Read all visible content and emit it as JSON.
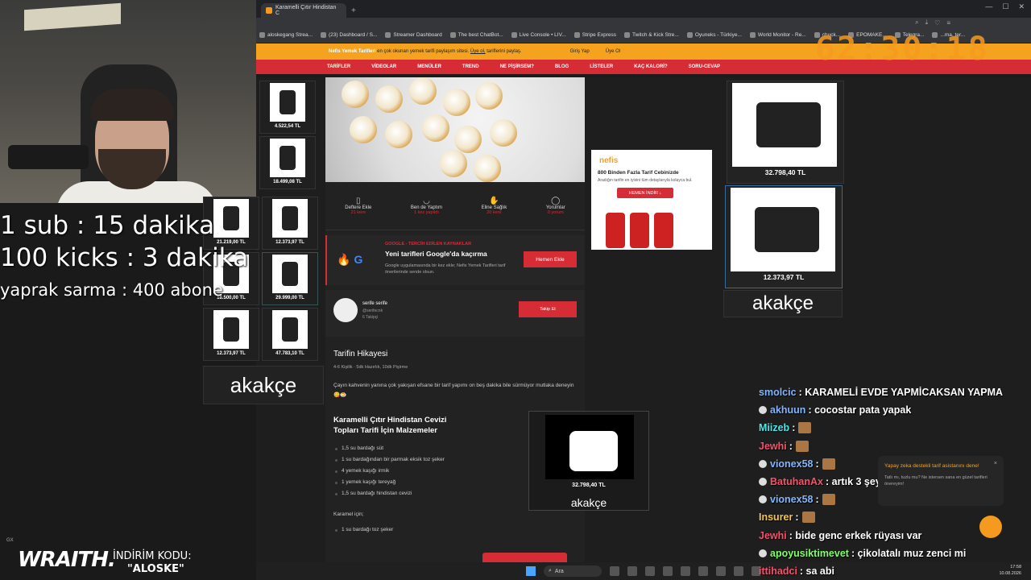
{
  "overlay": {
    "line1": "1 sub : 15 dakika",
    "line2": "100 kicks : 3 dakika",
    "line3": "yaprak sarma : 400 abone",
    "timer": "62:30:18",
    "sponsor_brand": "WRAITH.",
    "sponsor_label": "İNDİRİM KODU:",
    "sponsor_code": "\"ALOSKE\"",
    "gx": "GX"
  },
  "browser": {
    "tab_title": "Karamelli Çıtır Hindistan C",
    "bookmarks": [
      "aloskegang Strea...",
      "(23) Dashboard / S...",
      "Streamer Dashboard",
      "The best ChatBot...",
      "Live Console • LIV...",
      "Stripe Express",
      "Twitch & Kick Stre...",
      "Oyuneks - Türkiye...",
      "World Monitor - Re...",
      "chuck...",
      "EPOMAKE...",
      "Telegra...",
      "...ma, ter..."
    ]
  },
  "site": {
    "top_text_brand": "Nefis Yemek Tarifleri",
    "top_text": "en çok okunan yemek tarifi paylaşım sitesi.",
    "top_link": "Üye ol,",
    "top_text_end": "tariflerini paylaş.",
    "login": "Giriş Yap",
    "signup": "Üye Ol",
    "nav": [
      "TARİFLER",
      "VİDEOLAR",
      "MENÜLER",
      "TREND",
      "NE PİŞİRSEM?",
      "BLOG",
      "LİSTELER",
      "KAÇ KALORİ?",
      "SORU-CEVAP"
    ]
  },
  "stats": [
    {
      "label": "Deftere Ekle",
      "sub": "21 kere"
    },
    {
      "label": "Ben de Yaptım",
      "sub": "1 kez yapıldı"
    },
    {
      "label": "Eline Sağlık",
      "sub": "20 kere"
    },
    {
      "label": "Yorumlar",
      "sub": "0 yorum"
    }
  ],
  "google_box": {
    "source": "GOOGLE - TERCİH EDİLEN KAYNAKLAR",
    "title": "Yeni tarifleri Google'da kaçırma",
    "desc": "Google uygulamasında bir kez ekle; Nefis Yemek Tarifleri tarif önerilerinde sende olsun.",
    "button": "Hemen Ekle"
  },
  "author": {
    "name": "serife serife",
    "handle": "@serifecnk",
    "followers": "6 Takipçi",
    "follow": "Takip Et"
  },
  "story": {
    "title": "Tarifin Hikayesi",
    "meta": "4-6 Kişilik   ·   5dk Hazırlık, 10dk Pişirme",
    "text": "Çayın kahvenin yanına çok yakışan efsane bir tarif yapımı on beş dakika bile sürmüyor mutlaka deneyin😋🍮",
    "ing_title": "Karamelli Çıtır Hindistan Cevizi Topları Tarifi İçin Malzemeler",
    "ingredients": [
      "1,5 su bardağı süt",
      "1 su bardağından bir parmak eksik toz şeker",
      "4 yemek kaşığı irmik",
      "1 yemek kaşığı tereyağ",
      "1,5 su bardağı hindistan cevizi"
    ],
    "karamel": "Karamel için;",
    "karamel_items": [
      "1 su bardağı toz şeker"
    ]
  },
  "left_products": {
    "top": "4.522,54 TL",
    "second": "18.499,08 TL",
    "grid": [
      "21.219,00 TL",
      "12.373,97 TL",
      "18.500,00 TL",
      "29.999,00 TL",
      "12.373,97 TL",
      "47.783,10 TL"
    ],
    "brand": "akakçe"
  },
  "inline_ad": {
    "price": "32.798,40 TL",
    "brand": "akakçe"
  },
  "nefis_ad": {
    "logo": "nefis",
    "headline": "800 Binden Fazla Tarif Cebinizde",
    "desc": "Aradığın tarifin en iyisini tüm detaylarıyla kolayca bul.",
    "button": "HEMEN İNDİR ↓"
  },
  "right_products": {
    "p1": "32.798,40 TL",
    "p2": "12.373,97 TL",
    "brand": "akakçe"
  },
  "chat": [
    {
      "user": "smolcic",
      "color": "#7fb6ff",
      "text": ": KARAMELİ EVDE YAPMİCAKSAN YAPMA"
    },
    {
      "user": "akhuun",
      "color": "#7fb6ff",
      "text": ": cocostar pata yapak"
    },
    {
      "user": "Miizeb",
      "color": "#4ee6e6",
      "text": ":"
    },
    {
      "user": "Jewhi",
      "color": "#ff4d6a",
      "text": ":"
    },
    {
      "user": "vionex58",
      "color": "#7fb6ff",
      "text": ":"
    },
    {
      "user": "BatuhanAx",
      "color": "#ff4d6a",
      "text": ": artık 3 şey"
    },
    {
      "user": "vionex58",
      "color": "#7fb6ff",
      "text": ":"
    },
    {
      "user": "Insurer",
      "color": "#f5c542",
      "text": ":"
    },
    {
      "user": "Jewhi",
      "color": "#ff4d6a",
      "text": ": bide genc erkek rüyası var"
    },
    {
      "user": "apoyusiktimevet",
      "color": "#7fff6a",
      "text": ": çikolatalı muz zenci mi"
    },
    {
      "user": "ittihadci",
      "color": "#ff4d6a",
      "text": ": sa abi"
    }
  ],
  "popup": {
    "title": "Yapay zeka destekli tarif asistanını dene!",
    "desc": "Tatlı mı, tuzlu mu? Ne istersen sana en güzel tarifleri önereyim!",
    "close": "×"
  },
  "taskbar": {
    "search": "Ara",
    "time": "17:58",
    "date": "10.08.2026"
  }
}
